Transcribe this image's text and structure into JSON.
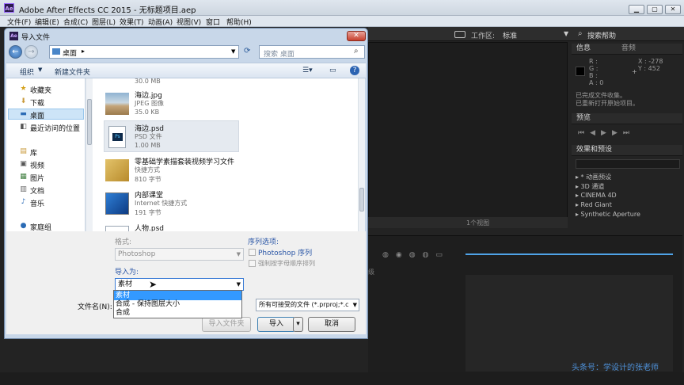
{
  "app": {
    "logo": "Ae",
    "title": "Adobe After Effects CC 2015 - 无标题项目.aep",
    "window_buttons": [
      "▁",
      "▢",
      "✕"
    ],
    "menu": [
      "文件(F)",
      "编辑(E)",
      "合成(C)",
      "图层(L)",
      "效果(T)",
      "动画(A)",
      "视图(V)",
      "窗口",
      "帮助(H)"
    ]
  },
  "workspace": {
    "label": "工作区:",
    "value": "标准",
    "search": "搜索帮助"
  },
  "info_panel": {
    "tabs": [
      "信息",
      "音频"
    ],
    "rgb": [
      "R :",
      "G :",
      "B :",
      "A : 0"
    ],
    "coords": [
      "X : -278",
      "Y : 452"
    ],
    "status": [
      "已完成文件收集。",
      "已重新打开原始项目。"
    ]
  },
  "preview_panel": {
    "title": "预览"
  },
  "effects_panel": {
    "title": "效果和预设",
    "items": [
      "▸ * 动画预设",
      "▸ 3D 通道",
      "▸ CINEMA 4D",
      "▸ Red Giant",
      "▸ Synthetic Aperture"
    ]
  },
  "viewer": {
    "view_select": "1个视图"
  },
  "watermark": "头条号：学设计的张老师",
  "dialog": {
    "logo": "Ae",
    "title": "导入文件",
    "close": "✕",
    "address": "桌面",
    "search_placeholder": "搜索 桌面",
    "commands": {
      "organize": "组织",
      "new_folder": "新建文件夹"
    },
    "nav": [
      {
        "label": "收藏夹",
        "icon": "star-icon"
      },
      {
        "label": "下载",
        "icon": "download-folder-icon"
      },
      {
        "label": "桌面",
        "icon": "desktop-icon"
      },
      {
        "label": "最近访问的位置",
        "icon": "recent-places-icon"
      },
      {
        "label": "库",
        "icon": "library-icon"
      },
      {
        "label": "视频",
        "icon": "video-library-icon"
      },
      {
        "label": "图片",
        "icon": "pictures-library-icon"
      },
      {
        "label": "文档",
        "icon": "documents-library-icon"
      },
      {
        "label": "音乐",
        "icon": "music-library-icon"
      },
      {
        "label": "家庭组",
        "icon": "homegroup-icon"
      }
    ],
    "files": [
      {
        "name": "",
        "type": "",
        "size": "30.0 MB"
      },
      {
        "name": "海边.jpg",
        "type": "JPEG 图像",
        "size": "35.0 KB"
      },
      {
        "name": "海边.psd",
        "type": "PSD 文件",
        "size": "1.00 MB"
      },
      {
        "name": "零基础学素描套装视频学习文件",
        "type": "快捷方式",
        "size": "810 字节"
      },
      {
        "name": "内部课堂",
        "type": "Internet 快捷方式",
        "size": "191 字节"
      },
      {
        "name": "人物.psd",
        "type": "",
        "size": ""
      }
    ],
    "format_label": "格式:",
    "format_value": "Photoshop",
    "sequence_options_label": "序列选项:",
    "photoshop_sequence": "Photoshop 序列",
    "force_alpha_order": "强制按字母顺序排列",
    "import_as_label": "导入为:",
    "import_as_value": "素材",
    "import_as_options": [
      "素材",
      "合成 - 保持图层大小",
      "合成"
    ],
    "filename_label": "文件名(N):",
    "filter_value": "所有可接受的文件 (*.prproj;*.c",
    "import_folder_button": "导入文件夹",
    "import_button": "导入",
    "cancel_button": "取消"
  }
}
